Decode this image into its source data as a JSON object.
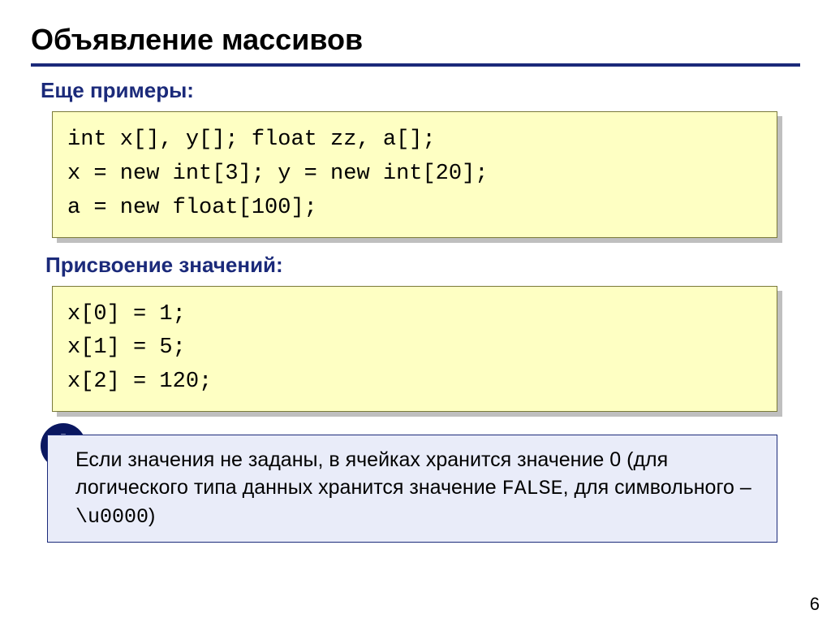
{
  "title": "Объявление массивов",
  "section1_heading": "Еще примеры:",
  "code1": "int x[], y[]; float zz, a[];\nx = new int[3]; y = new int[20];\na = new float[100];",
  "section2_heading": "Присвоение значений:",
  "code2": "x[0] = 1;\nx[1] = 5;\nx[2] = 120;",
  "note_bang": "!",
  "note_text_1": "   Если значения не заданы, в ячейках хранится значение 0 (для логического типа данных хранится значение ",
  "note_mono_1": "FALSE",
  "note_text_2": ", для символьного – ",
  "note_mono_2": "\\u0000",
  "note_text_3": ")",
  "page_number": "6"
}
